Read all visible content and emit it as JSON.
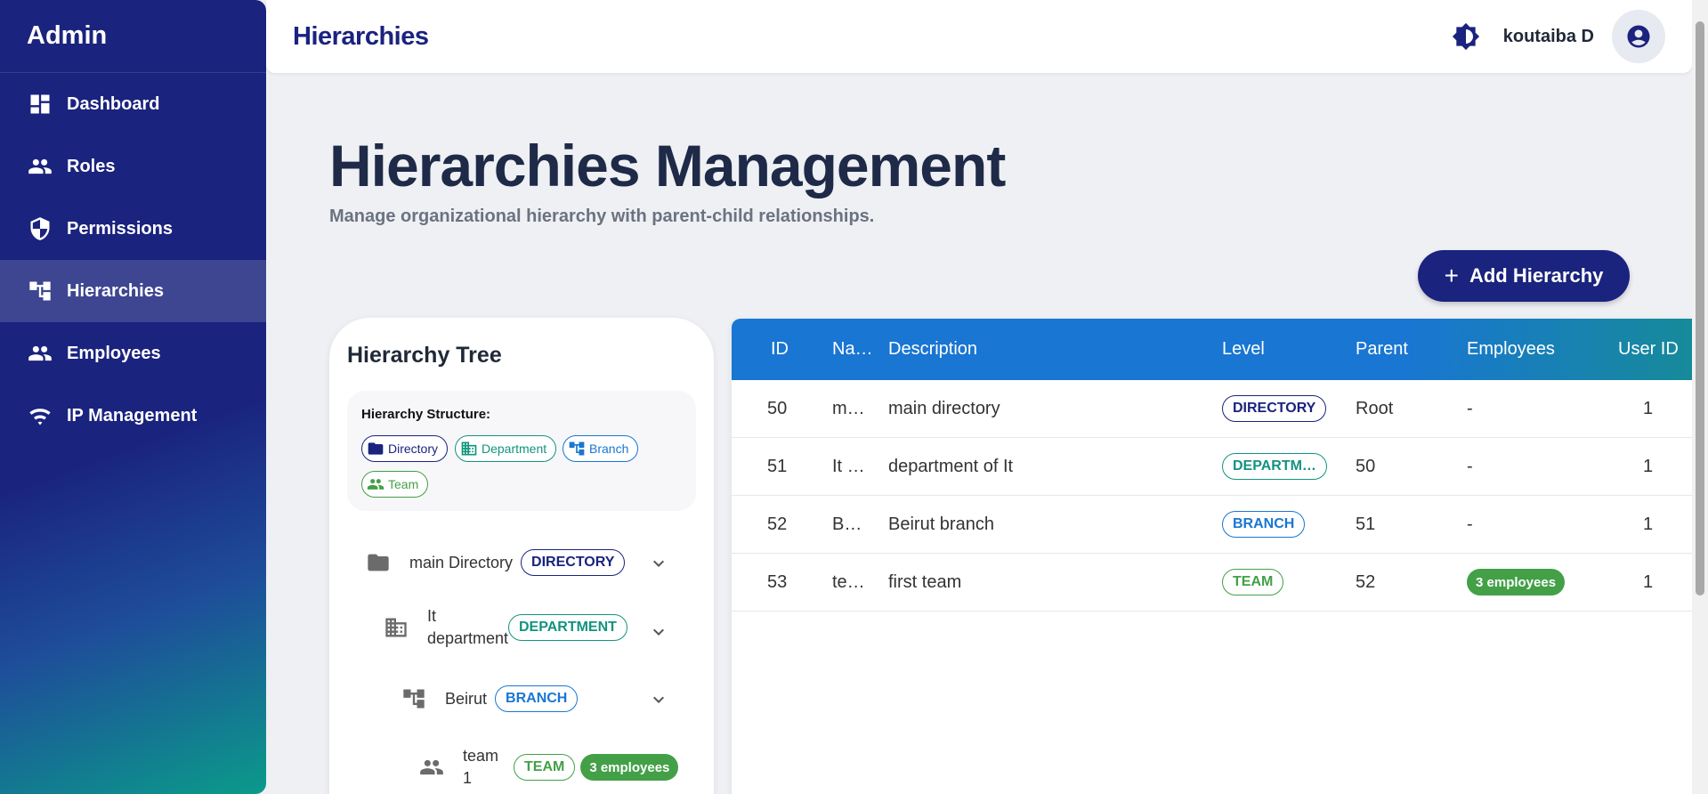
{
  "sidebar": {
    "brand": "Admin",
    "items": [
      {
        "label": "Dashboard",
        "icon": "dashboard-icon"
      },
      {
        "label": "Roles",
        "icon": "people-icon"
      },
      {
        "label": "Permissions",
        "icon": "shield-icon"
      },
      {
        "label": "Hierarchies",
        "icon": "hierarchy-icon",
        "active": true
      },
      {
        "label": "Employees",
        "icon": "people-icon"
      },
      {
        "label": "IP Management",
        "icon": "network-icon"
      }
    ]
  },
  "topbar": {
    "title": "Hierarchies",
    "username": "koutaiba D",
    "theme_icon": "brightness-icon",
    "avatar_icon": "account-circle-icon"
  },
  "page": {
    "heading": "Hierarchies Management",
    "subtitle": "Manage organizational hierarchy with parent-child relationships.",
    "add_button": "Add Hierarchy",
    "add_icon": "+"
  },
  "tree": {
    "title": "Hierarchy Tree",
    "structure_label": "Hierarchy Structure:",
    "legend": [
      "Directory",
      "Department",
      "Branch",
      "Team"
    ],
    "nodes": [
      {
        "label": "main Directory",
        "badge": "DIRECTORY",
        "icon": "folder-icon"
      },
      {
        "label": "It department",
        "badge": "DEPARTMENT",
        "icon": "building-icon"
      },
      {
        "label": "Beirut",
        "badge": "BRANCH",
        "icon": "hierarchy-icon"
      },
      {
        "label": "team 1",
        "badge": "TEAM",
        "icon": "people-icon",
        "employees": "3 employees"
      }
    ]
  },
  "table": {
    "headers": [
      "ID",
      "Na…",
      "Description",
      "Level",
      "Parent",
      "Employees",
      "User ID"
    ],
    "rows": [
      {
        "id": "50",
        "name": "m…",
        "description": "main directory",
        "level": "DIRECTORY",
        "parent": "Root",
        "employees": "-",
        "user_id": "1"
      },
      {
        "id": "51",
        "name": "It …",
        "description": "department of It",
        "level": "DEPARTM…",
        "parent": "50",
        "employees": "-",
        "user_id": "1"
      },
      {
        "id": "52",
        "name": "B…",
        "description": "Beirut branch",
        "level": "BRANCH",
        "parent": "51",
        "employees": "-",
        "user_id": "1"
      },
      {
        "id": "53",
        "name": "te…",
        "description": "first team",
        "level": "TEAM",
        "parent": "52",
        "employees": "3 employees",
        "user_id": "1"
      }
    ]
  },
  "colors": {
    "primary": "#1a237e",
    "table_header": "#1976d2",
    "department": "#12937f",
    "branch": "#1976d2",
    "team": "#43a047"
  }
}
